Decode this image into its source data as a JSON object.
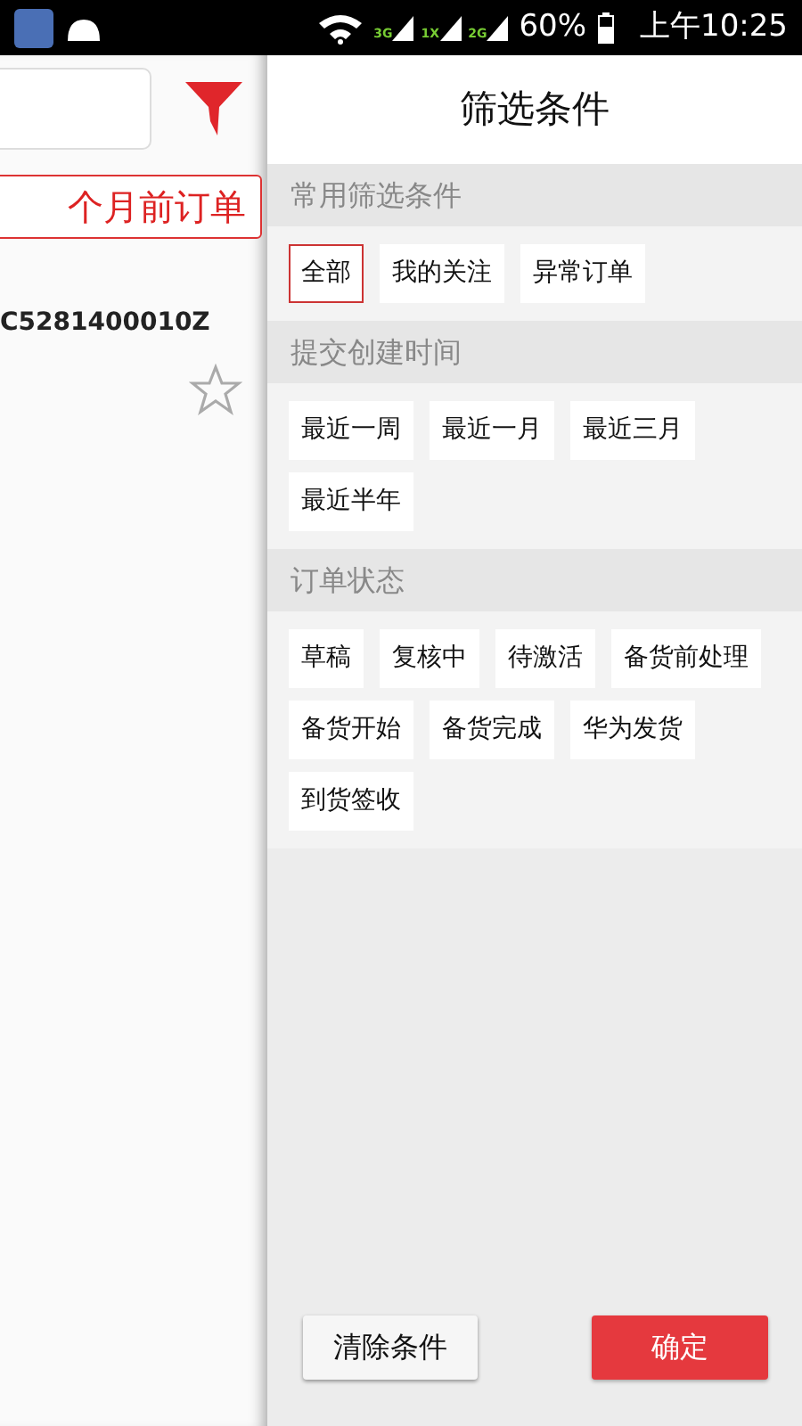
{
  "status_bar": {
    "network_labels": [
      "3G",
      "1X",
      "2G"
    ],
    "battery": "60%",
    "time": "上午10:25"
  },
  "order_list": {
    "period_tab": "个月前订单",
    "order_number": "C5281400010Z",
    "starred": false
  },
  "drawer": {
    "title": "筛选条件",
    "sections": [
      {
        "title": "常用筛选条件",
        "options": [
          {
            "label": "全部",
            "selected": true
          },
          {
            "label": "我的关注",
            "selected": false
          },
          {
            "label": "异常订单",
            "selected": false
          }
        ]
      },
      {
        "title": "提交创建时间",
        "options": [
          {
            "label": "最近一周",
            "selected": false
          },
          {
            "label": "最近一月",
            "selected": false
          },
          {
            "label": "最近三月",
            "selected": false
          },
          {
            "label": "最近半年",
            "selected": false
          }
        ]
      },
      {
        "title": "订单状态",
        "options": [
          {
            "label": "草稿",
            "selected": false
          },
          {
            "label": "复核中",
            "selected": false
          },
          {
            "label": "待激活",
            "selected": false
          },
          {
            "label": "备货前处理",
            "selected": false
          },
          {
            "label": "备货开始",
            "selected": false
          },
          {
            "label": "备货完成",
            "selected": false
          },
          {
            "label": "华为发货",
            "selected": false
          },
          {
            "label": "到货签收",
            "selected": false
          }
        ]
      }
    ],
    "buttons": [
      {
        "label": "清除条件",
        "kind": "secondary"
      },
      {
        "label": "确定",
        "kind": "primary"
      }
    ]
  }
}
